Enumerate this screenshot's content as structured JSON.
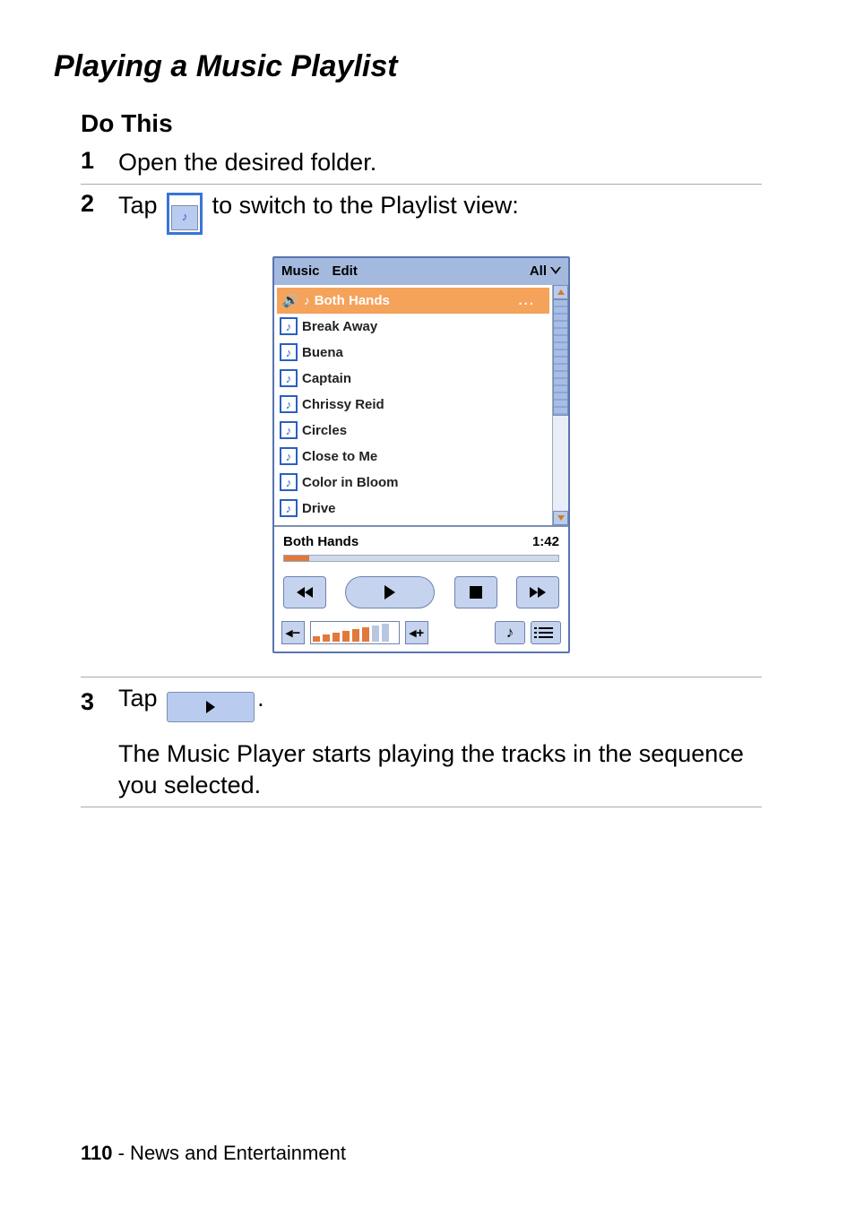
{
  "title": "Playing a Music Playlist",
  "do_this": "Do This",
  "steps": [
    {
      "num": "1",
      "text": "Open the desired folder."
    },
    {
      "num": "2",
      "tap": "Tap",
      "after": " to switch to the Playlist view:"
    },
    {
      "num": "3",
      "tap": "Tap",
      "period": ".",
      "explain": "The Music Player starts playing the tracks in the sequence you selected."
    }
  ],
  "player": {
    "titlebar": {
      "menu1": "Music",
      "menu2": "Edit",
      "filter": "All"
    },
    "tracks": [
      {
        "name": "Both Hands",
        "selected": true
      },
      {
        "name": "Break Away"
      },
      {
        "name": "Buena"
      },
      {
        "name": "Captain"
      },
      {
        "name": "Chrissy Reid"
      },
      {
        "name": "Circles"
      },
      {
        "name": "Close to Me"
      },
      {
        "name": "Color in Bloom"
      },
      {
        "name": "Drive"
      }
    ],
    "now_playing": {
      "track": "Both Hands",
      "time": "1:42"
    }
  },
  "footer": {
    "page": "110",
    "section": " - News and Entertainment"
  }
}
